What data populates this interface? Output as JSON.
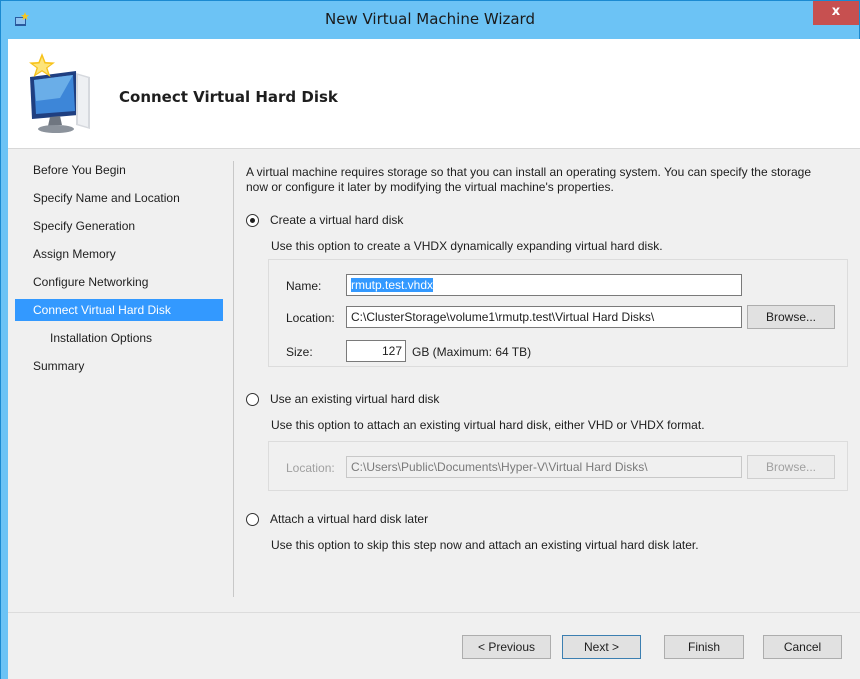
{
  "window": {
    "title": "New Virtual Machine Wizard",
    "close_glyph": "x"
  },
  "header": {
    "title": "Connect Virtual Hard Disk",
    "icon": "computer-with-star-icon"
  },
  "nav": {
    "items": [
      {
        "label": "Before You Begin"
      },
      {
        "label": "Specify Name and Location"
      },
      {
        "label": "Specify Generation"
      },
      {
        "label": "Assign Memory"
      },
      {
        "label": "Configure Networking"
      },
      {
        "label": "Connect Virtual Hard Disk"
      },
      {
        "label": "Installation Options"
      },
      {
        "label": "Summary"
      }
    ],
    "active_index": 5
  },
  "main": {
    "intro": "A virtual machine requires storage so that you can install an operating system. You can specify the storage now or configure it later by modifying the virtual machine's properties.",
    "option_create": {
      "label": "Create a virtual hard disk",
      "description": "Use this option to create a VHDX dynamically expanding virtual hard disk.",
      "selected": true,
      "name_label": "Name:",
      "name_value": "rmutp.test.vhdx",
      "location_label": "Location:",
      "location_value": "C:\\ClusterStorage\\volume1\\rmutp.test\\Virtual Hard Disks\\",
      "browse_label": "Browse...",
      "size_label": "Size:",
      "size_value": "127",
      "size_unit": "GB (Maximum: 64 TB)"
    },
    "option_existing": {
      "label": "Use an existing virtual hard disk",
      "description": "Use this option to attach an existing virtual hard disk, either VHD or VHDX format.",
      "selected": false,
      "location_label": "Location:",
      "location_value": "C:\\Users\\Public\\Documents\\Hyper-V\\Virtual Hard Disks\\",
      "browse_label": "Browse..."
    },
    "option_later": {
      "label": "Attach a virtual hard disk later",
      "description": "Use this option to skip this step now and attach an existing virtual hard disk later.",
      "selected": false
    }
  },
  "footer": {
    "previous_label": "< Previous",
    "next_label": "Next >",
    "finish_label": "Finish",
    "cancel_label": "Cancel"
  },
  "colors": {
    "titlebar": "#6cc3f5",
    "selection": "#3399ff",
    "close": "#c75050"
  }
}
